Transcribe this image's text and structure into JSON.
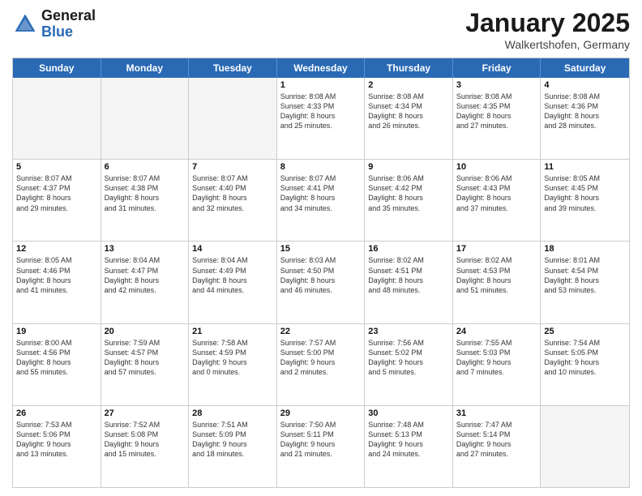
{
  "logo": {
    "general": "General",
    "blue": "Blue"
  },
  "title": {
    "month": "January 2025",
    "location": "Walkertshofen, Germany"
  },
  "header_days": [
    "Sunday",
    "Monday",
    "Tuesday",
    "Wednesday",
    "Thursday",
    "Friday",
    "Saturday"
  ],
  "weeks": [
    [
      {
        "day": "",
        "empty": true,
        "lines": []
      },
      {
        "day": "",
        "empty": true,
        "lines": []
      },
      {
        "day": "",
        "empty": true,
        "lines": []
      },
      {
        "day": "1",
        "empty": false,
        "lines": [
          "Sunrise: 8:08 AM",
          "Sunset: 4:33 PM",
          "Daylight: 8 hours",
          "and 25 minutes."
        ]
      },
      {
        "day": "2",
        "empty": false,
        "lines": [
          "Sunrise: 8:08 AM",
          "Sunset: 4:34 PM",
          "Daylight: 8 hours",
          "and 26 minutes."
        ]
      },
      {
        "day": "3",
        "empty": false,
        "lines": [
          "Sunrise: 8:08 AM",
          "Sunset: 4:35 PM",
          "Daylight: 8 hours",
          "and 27 minutes."
        ]
      },
      {
        "day": "4",
        "empty": false,
        "lines": [
          "Sunrise: 8:08 AM",
          "Sunset: 4:36 PM",
          "Daylight: 8 hours",
          "and 28 minutes."
        ]
      }
    ],
    [
      {
        "day": "5",
        "empty": false,
        "lines": [
          "Sunrise: 8:07 AM",
          "Sunset: 4:37 PM",
          "Daylight: 8 hours",
          "and 29 minutes."
        ]
      },
      {
        "day": "6",
        "empty": false,
        "lines": [
          "Sunrise: 8:07 AM",
          "Sunset: 4:38 PM",
          "Daylight: 8 hours",
          "and 31 minutes."
        ]
      },
      {
        "day": "7",
        "empty": false,
        "lines": [
          "Sunrise: 8:07 AM",
          "Sunset: 4:40 PM",
          "Daylight: 8 hours",
          "and 32 minutes."
        ]
      },
      {
        "day": "8",
        "empty": false,
        "lines": [
          "Sunrise: 8:07 AM",
          "Sunset: 4:41 PM",
          "Daylight: 8 hours",
          "and 34 minutes."
        ]
      },
      {
        "day": "9",
        "empty": false,
        "lines": [
          "Sunrise: 8:06 AM",
          "Sunset: 4:42 PM",
          "Daylight: 8 hours",
          "and 35 minutes."
        ]
      },
      {
        "day": "10",
        "empty": false,
        "lines": [
          "Sunrise: 8:06 AM",
          "Sunset: 4:43 PM",
          "Daylight: 8 hours",
          "and 37 minutes."
        ]
      },
      {
        "day": "11",
        "empty": false,
        "lines": [
          "Sunrise: 8:05 AM",
          "Sunset: 4:45 PM",
          "Daylight: 8 hours",
          "and 39 minutes."
        ]
      }
    ],
    [
      {
        "day": "12",
        "empty": false,
        "lines": [
          "Sunrise: 8:05 AM",
          "Sunset: 4:46 PM",
          "Daylight: 8 hours",
          "and 41 minutes."
        ]
      },
      {
        "day": "13",
        "empty": false,
        "lines": [
          "Sunrise: 8:04 AM",
          "Sunset: 4:47 PM",
          "Daylight: 8 hours",
          "and 42 minutes."
        ]
      },
      {
        "day": "14",
        "empty": false,
        "lines": [
          "Sunrise: 8:04 AM",
          "Sunset: 4:49 PM",
          "Daylight: 8 hours",
          "and 44 minutes."
        ]
      },
      {
        "day": "15",
        "empty": false,
        "lines": [
          "Sunrise: 8:03 AM",
          "Sunset: 4:50 PM",
          "Daylight: 8 hours",
          "and 46 minutes."
        ]
      },
      {
        "day": "16",
        "empty": false,
        "lines": [
          "Sunrise: 8:02 AM",
          "Sunset: 4:51 PM",
          "Daylight: 8 hours",
          "and 48 minutes."
        ]
      },
      {
        "day": "17",
        "empty": false,
        "lines": [
          "Sunrise: 8:02 AM",
          "Sunset: 4:53 PM",
          "Daylight: 8 hours",
          "and 51 minutes."
        ]
      },
      {
        "day": "18",
        "empty": false,
        "lines": [
          "Sunrise: 8:01 AM",
          "Sunset: 4:54 PM",
          "Daylight: 8 hours",
          "and 53 minutes."
        ]
      }
    ],
    [
      {
        "day": "19",
        "empty": false,
        "lines": [
          "Sunrise: 8:00 AM",
          "Sunset: 4:56 PM",
          "Daylight: 8 hours",
          "and 55 minutes."
        ]
      },
      {
        "day": "20",
        "empty": false,
        "lines": [
          "Sunrise: 7:59 AM",
          "Sunset: 4:57 PM",
          "Daylight: 8 hours",
          "and 57 minutes."
        ]
      },
      {
        "day": "21",
        "empty": false,
        "lines": [
          "Sunrise: 7:58 AM",
          "Sunset: 4:59 PM",
          "Daylight: 9 hours",
          "and 0 minutes."
        ]
      },
      {
        "day": "22",
        "empty": false,
        "lines": [
          "Sunrise: 7:57 AM",
          "Sunset: 5:00 PM",
          "Daylight: 9 hours",
          "and 2 minutes."
        ]
      },
      {
        "day": "23",
        "empty": false,
        "lines": [
          "Sunrise: 7:56 AM",
          "Sunset: 5:02 PM",
          "Daylight: 9 hours",
          "and 5 minutes."
        ]
      },
      {
        "day": "24",
        "empty": false,
        "lines": [
          "Sunrise: 7:55 AM",
          "Sunset: 5:03 PM",
          "Daylight: 9 hours",
          "and 7 minutes."
        ]
      },
      {
        "day": "25",
        "empty": false,
        "lines": [
          "Sunrise: 7:54 AM",
          "Sunset: 5:05 PM",
          "Daylight: 9 hours",
          "and 10 minutes."
        ]
      }
    ],
    [
      {
        "day": "26",
        "empty": false,
        "lines": [
          "Sunrise: 7:53 AM",
          "Sunset: 5:06 PM",
          "Daylight: 9 hours",
          "and 13 minutes."
        ]
      },
      {
        "day": "27",
        "empty": false,
        "lines": [
          "Sunrise: 7:52 AM",
          "Sunset: 5:08 PM",
          "Daylight: 9 hours",
          "and 15 minutes."
        ]
      },
      {
        "day": "28",
        "empty": false,
        "lines": [
          "Sunrise: 7:51 AM",
          "Sunset: 5:09 PM",
          "Daylight: 9 hours",
          "and 18 minutes."
        ]
      },
      {
        "day": "29",
        "empty": false,
        "lines": [
          "Sunrise: 7:50 AM",
          "Sunset: 5:11 PM",
          "Daylight: 9 hours",
          "and 21 minutes."
        ]
      },
      {
        "day": "30",
        "empty": false,
        "lines": [
          "Sunrise: 7:48 AM",
          "Sunset: 5:13 PM",
          "Daylight: 9 hours",
          "and 24 minutes."
        ]
      },
      {
        "day": "31",
        "empty": false,
        "lines": [
          "Sunrise: 7:47 AM",
          "Sunset: 5:14 PM",
          "Daylight: 9 hours",
          "and 27 minutes."
        ]
      },
      {
        "day": "",
        "empty": true,
        "lines": []
      }
    ]
  ]
}
